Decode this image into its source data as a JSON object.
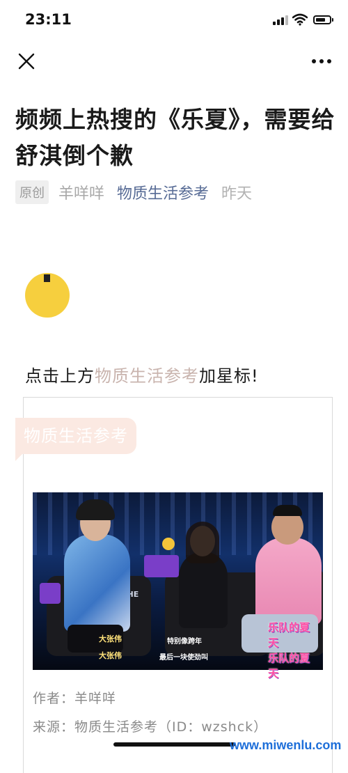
{
  "status_bar": {
    "time": "23:11"
  },
  "article": {
    "title": "频频上热搜的《乐夏》，需要给舒淇倒个歉",
    "original_tag": "原创",
    "author": "羊咩咩",
    "account": "物质生活参考",
    "date": "昨天",
    "star_prefix": "点击上方",
    "star_account": "物质生活参考",
    "star_suffix": "加星标!"
  },
  "card": {
    "bubble_label": "物质生活参考",
    "photo": {
      "name_tag_1": "大张伟",
      "name_tag_2": "大张伟",
      "subtitle_1": "特别像跨年",
      "subtitle_2": "最后一块使劲叫",
      "stage_text": "THE",
      "show_logo_1": "乐队的夏天",
      "show_logo_2": "乐队的夏天"
    },
    "author_line": "作者：羊咩咩",
    "source_line": "来源：物质生活参考（ID：wzshck）"
  },
  "watermark": "www.miwenlu.com",
  "icons": [
    "close-icon",
    "more-icon",
    "signal-icon",
    "wifi-icon",
    "battery-icon"
  ],
  "colors": {
    "account_link": "#576b95",
    "dot": "#f6cf3e",
    "bubble": "#fbe9e2"
  }
}
